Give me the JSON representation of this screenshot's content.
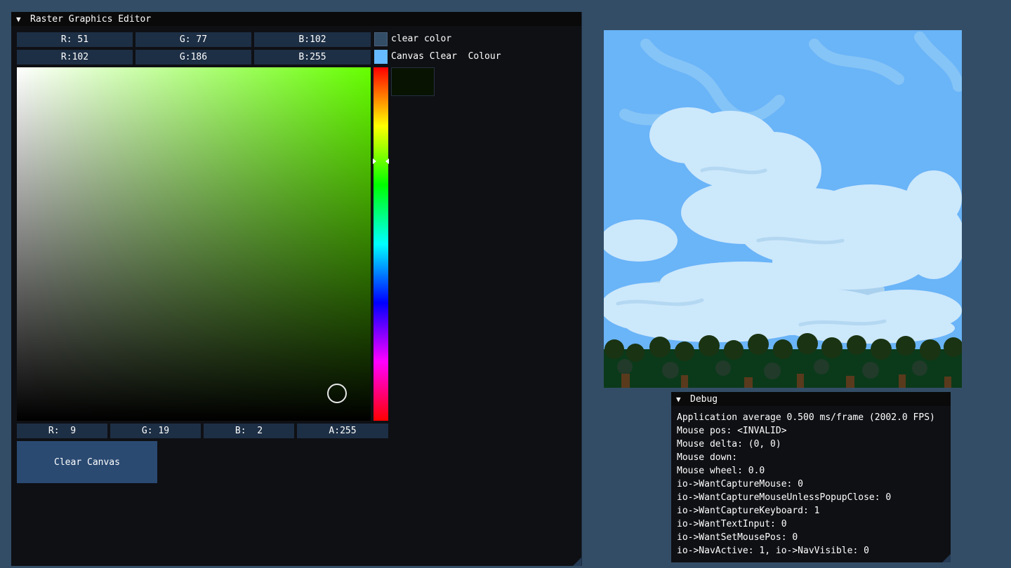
{
  "editor": {
    "title": "Raster Graphics Editor",
    "collapse_icon": "triangle-down-icon",
    "clear_color": {
      "r": "R: 51",
      "g": "G: 77",
      "b": "B:102",
      "swatch": "#334d66",
      "label": "clear color"
    },
    "canvas_clear": {
      "r": "R:102",
      "g": "G:186",
      "b": "B:255",
      "swatch": "#66baff",
      "label": "Canvas Clear  Colour"
    },
    "picker": {
      "hue_color": "#66ff00",
      "preview_color": "#091302"
    },
    "brush": {
      "r": "R:  9",
      "g": "G: 19",
      "b": "B:  2",
      "a": "A:255"
    },
    "clear_button": "Clear Canvas"
  },
  "canvas": {
    "sky_color": "#6ab4f8",
    "cloud_color": "#cce8fb",
    "cloud_shadow": "#a9d1ee",
    "foliage_color": "#0f3a16"
  },
  "debug": {
    "title": "Debug",
    "collapse_icon": "triangle-down-icon",
    "lines": [
      "Application average 0.500 ms/frame (2002.0 FPS)",
      "Mouse pos: <INVALID>",
      "Mouse delta: (0, 0)",
      "Mouse down:",
      "Mouse wheel: 0.0",
      "io->WantCaptureMouse: 0",
      "io->WantCaptureMouseUnlessPopupClose: 0",
      "io->WantCaptureKeyboard: 1",
      "io->WantTextInput: 0",
      "io->WantSetMousePos: 0",
      "io->NavActive: 1, io->NavVisible: 0"
    ]
  }
}
